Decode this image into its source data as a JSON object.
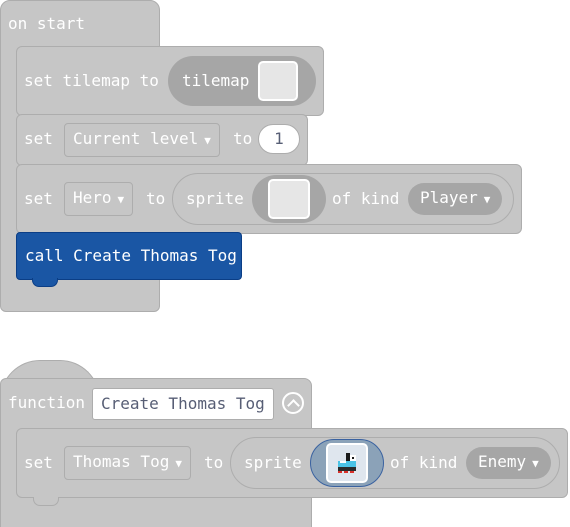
{
  "on_start": {
    "title": "on start",
    "set_tilemap": {
      "set_label": "set tilemap to",
      "tilemap_label": "tilemap"
    },
    "set_level": {
      "set_label": "set",
      "variable": "Current level",
      "to_label": "to",
      "value": "1"
    },
    "set_hero": {
      "set_label": "set",
      "variable": "Hero",
      "to_label": "to",
      "sprite_label": "sprite",
      "of_kind_label": "of kind",
      "kind": "Player"
    },
    "call": {
      "label": "call Create Thomas Tog"
    }
  },
  "function_block": {
    "function_label": "function",
    "name": "Create Thomas Tog",
    "set_thomas": {
      "set_label": "set",
      "variable": "Thomas Tog",
      "to_label": "to",
      "sprite_label": "sprite",
      "of_kind_label": "of kind",
      "kind": "Enemy"
    }
  },
  "colors": {
    "block_gray": "#c6c6c6",
    "block_border": "#adadad",
    "call_blue": "#1a56a4",
    "text_white": "#ffffff"
  },
  "icons": {
    "dropdown": "caret-down",
    "collapse": "chevron-up-circle",
    "sprite": "train-sprite-image"
  }
}
